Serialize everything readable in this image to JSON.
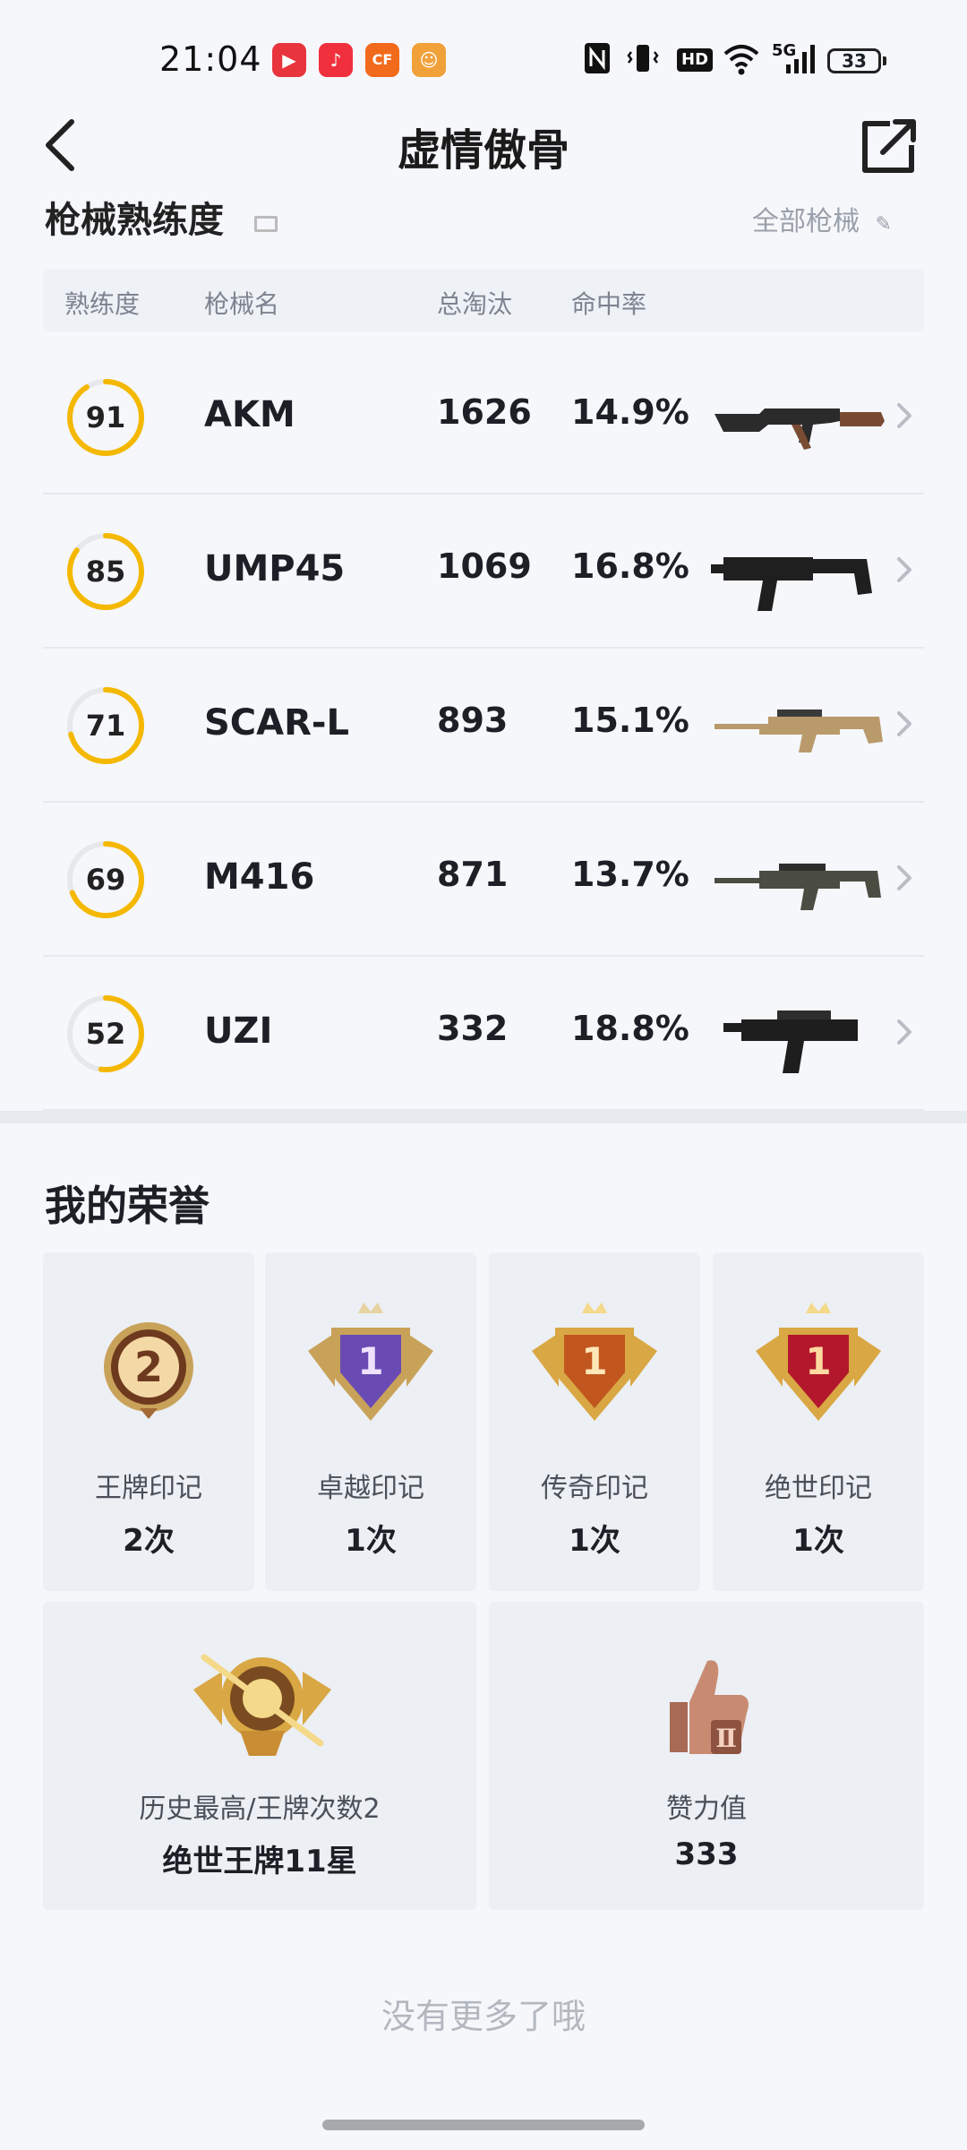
{
  "status_bar": {
    "time": "21:04",
    "battery": "33",
    "network": "5G",
    "hd": "HD"
  },
  "header": {
    "title": "虚情傲骨"
  },
  "weapons_section": {
    "title": "枪械熟练度",
    "all_link": "全部枪械"
  },
  "table": {
    "headers": {
      "proficiency": "熟练度",
      "gun_name": "枪械名",
      "kills": "总淘汰",
      "hit_rate": "命中率"
    },
    "rows": [
      {
        "proficiency": "91",
        "proficiency_fraction": 0.91,
        "name": "AKM",
        "kills": "1626",
        "hit_rate": "14.9%",
        "icon": "akm-rifle-icon"
      },
      {
        "proficiency": "85",
        "proficiency_fraction": 0.85,
        "name": "UMP45",
        "kills": "1069",
        "hit_rate": "16.8%",
        "icon": "ump45-smg-icon"
      },
      {
        "proficiency": "71",
        "proficiency_fraction": 0.71,
        "name": "SCAR-L",
        "kills": "893",
        "hit_rate": "15.1%",
        "icon": "scar-l-rifle-icon"
      },
      {
        "proficiency": "69",
        "proficiency_fraction": 0.69,
        "name": "M416",
        "kills": "871",
        "hit_rate": "13.7%",
        "icon": "m416-rifle-icon"
      },
      {
        "proficiency": "52",
        "proficiency_fraction": 0.52,
        "name": "UZI",
        "kills": "332",
        "hit_rate": "18.8%",
        "icon": "uzi-smg-icon"
      }
    ]
  },
  "honors": {
    "title": "我的荣誉",
    "badges": [
      {
        "label": "王牌印记",
        "value": "2次",
        "badge_number": "2",
        "icon": "ace-mark-badge-icon"
      },
      {
        "label": "卓越印记",
        "value": "1次",
        "badge_number": "1",
        "icon": "excellence-mark-badge-icon"
      },
      {
        "label": "传奇印记",
        "value": "1次",
        "badge_number": "1",
        "icon": "legend-mark-badge-icon"
      },
      {
        "label": "绝世印记",
        "value": "1次",
        "badge_number": "1",
        "icon": "peerless-mark-badge-icon"
      }
    ],
    "highest": {
      "label": "历史最高/王牌次数2",
      "value": "绝世王牌11星",
      "icon": "rank-emblem-icon"
    },
    "likes": {
      "label": "赞力值",
      "value": "333",
      "icon": "thumbs-up-trophy-icon"
    }
  },
  "footer": {
    "no_more": "没有更多了哦"
  },
  "colors": {
    "ring_progress": "#f5b800",
    "ring_track": "#e6e8ec",
    "background": "#f5f7fb"
  }
}
